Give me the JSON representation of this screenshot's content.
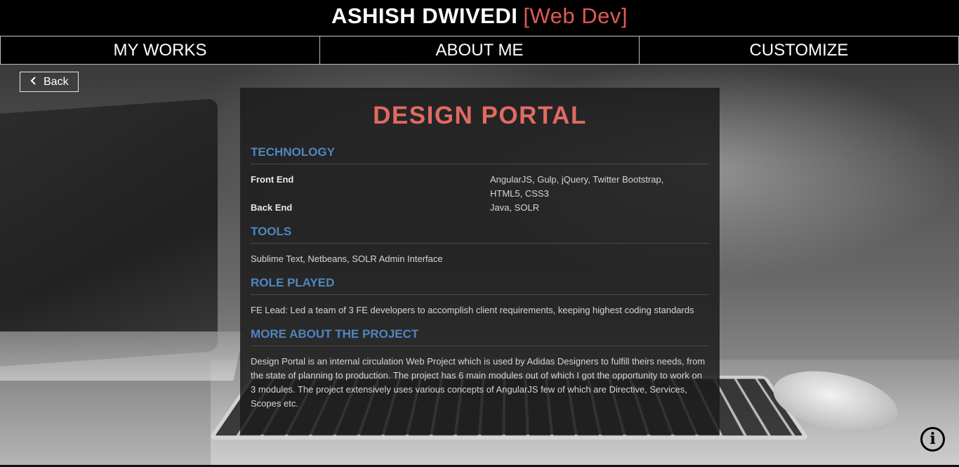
{
  "header": {
    "name": "ASHISH DWIVEDI",
    "role": "[Web Dev]"
  },
  "nav": {
    "items": [
      {
        "label": "MY WORKS"
      },
      {
        "label": "ABOUT ME"
      },
      {
        "label": "CUSTOMIZE"
      }
    ]
  },
  "back_button": {
    "icon": "chevron-left-icon",
    "label": "Back"
  },
  "project": {
    "title": "DESIGN PORTAL",
    "technology": {
      "heading": "TECHNOLOGY",
      "rows": [
        {
          "label": "Front End",
          "value": "AngularJS, Gulp, jQuery, Twitter Bootstrap, HTML5, CSS3"
        },
        {
          "label": "Back End",
          "value": "Java, SOLR"
        }
      ]
    },
    "tools": {
      "heading": "TOOLS",
      "text": "Sublime Text, Netbeans, SOLR Admin Interface"
    },
    "role": {
      "heading": "ROLE PLAYED",
      "text": "FE Lead: Led a team of 3 FE developers to accomplish client requirements, keeping highest coding standards"
    },
    "more": {
      "heading": "MORE ABOUT THE PROJECT",
      "text": "Design Portal is an internal circulation Web Project which is used by Adidas Designers to fulfill theirs needs, from the state of planning to production. The project has 6 main modules out of which I got the opportunity to work on 3 modules. The project extensively uses various concepts of AngularJS few of which are Directive, Services, Scopes etc."
    }
  },
  "info_button": {
    "icon": "info-icon",
    "glyph": "i"
  },
  "colors": {
    "accent_red": "#e05a56",
    "heading_blue": "#4f86c0",
    "header_bg": "#000000"
  }
}
